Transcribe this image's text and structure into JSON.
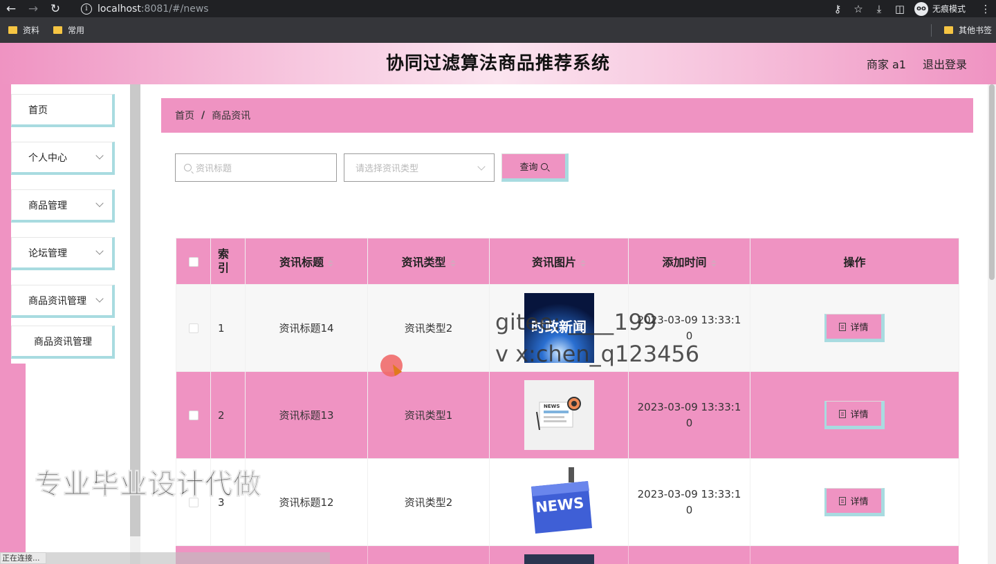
{
  "browser": {
    "url_host": "localhost",
    "url_rest": ":8081/#/news",
    "incognito_label": "无痕模式",
    "bookmarks": [
      "资料",
      "常用"
    ],
    "other_bookmarks": "其他书签"
  },
  "header": {
    "title": "协同过滤算法商品推荐系统",
    "user": "商家 a1",
    "logout": "退出登录"
  },
  "sidebar": {
    "items": [
      {
        "label": "首页"
      },
      {
        "label": "个人中心"
      },
      {
        "label": "商品管理"
      },
      {
        "label": "论坛管理"
      },
      {
        "label": "商品资讯管理"
      }
    ],
    "submenu": "商品资讯管理"
  },
  "breadcrumb": {
    "home": "首页",
    "separator": "/",
    "current": "商品资讯"
  },
  "search": {
    "title_placeholder": "资讯标题",
    "type_placeholder": "请选择资讯类型",
    "query_label": "查询"
  },
  "table": {
    "headers": {
      "index": "索引",
      "title": "资讯标题",
      "type": "资讯类型",
      "image": "资讯图片",
      "time": "添加时间",
      "action": "操作"
    },
    "rows": [
      {
        "index": "1",
        "title": "资讯标题14",
        "type": "资讯类型2",
        "time": "2023-03-09 13:33:10",
        "image_text": "时政新闻"
      },
      {
        "index": "2",
        "title": "资讯标题13",
        "type": "资讯类型1",
        "time": "2023-03-09 13:33:10",
        "image_text": "NEWS"
      },
      {
        "index": "3",
        "title": "资讯标题12",
        "type": "资讯类型2",
        "time": "2023-03-09 13:33:10",
        "image_text": "NEWS"
      }
    ],
    "detail_label": "详情"
  },
  "overlay": {
    "watermark_line1": "gitee: ____199",
    "watermark_line2": "v x:chen_q123456",
    "promo": "专业毕业设计代做",
    "status": "正在连接..."
  },
  "colors": {
    "accent_pink": "#ef93c2",
    "accent_teal": "#a8dbe0"
  }
}
